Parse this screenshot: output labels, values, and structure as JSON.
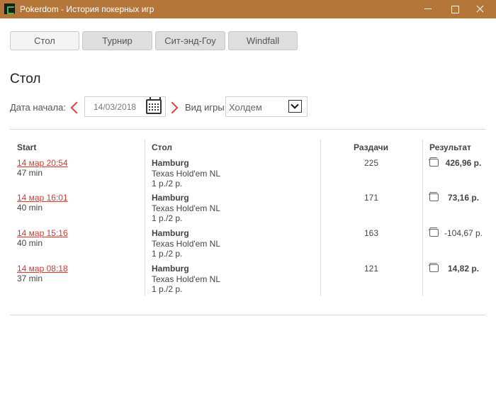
{
  "window": {
    "title": "Pokerdom - История покерных игр"
  },
  "tabs": [
    {
      "label": "Стол",
      "active": true
    },
    {
      "label": "Турнир",
      "active": false
    },
    {
      "label": "Сит-энд-Гоу",
      "active": false
    },
    {
      "label": "Windfall",
      "active": false
    }
  ],
  "page": {
    "heading": "Стол"
  },
  "filters": {
    "date_label": "Дата начала:",
    "date_value": "14/03/2018",
    "game_label": "Вид игры:",
    "game_value": "Холдем"
  },
  "table": {
    "headers": {
      "start": "Start",
      "table": "Стол",
      "hands": "Раздачи",
      "result": "Результат"
    },
    "rows": [
      {
        "start": "14 мар 20:54",
        "duration": "47 min",
        "table_name": "Hamburg",
        "game": "Texas Hold'em NL",
        "stakes": "1 р./2 р.",
        "hands": "225",
        "result": "426,96 р.",
        "result_bold": true
      },
      {
        "start": "14 мар 16:01",
        "duration": "40 min",
        "table_name": "Hamburg",
        "game": "Texas Hold'em NL",
        "stakes": "1 р./2 р.",
        "hands": "171",
        "result": "73,16 р.",
        "result_bold": true
      },
      {
        "start": "14 мар 15:16",
        "duration": "40 min",
        "table_name": "Hamburg",
        "game": "Texas Hold'em NL",
        "stakes": "1 р./2 р.",
        "hands": "163",
        "result": "-104,67 р.",
        "result_bold": false
      },
      {
        "start": "14 мар 08:18",
        "duration": "37 min",
        "table_name": "Hamburg",
        "game": "Texas Hold'em NL",
        "stakes": "1 р./2 р.",
        "hands": "121",
        "result": "14,82 р.",
        "result_bold": true
      }
    ]
  },
  "colors": {
    "titlebar": "#b5763a",
    "link": "#d63a2f",
    "arrow": "#d8423e"
  },
  "icons": [
    "pokerdom-logo-icon",
    "minimize-icon",
    "maximize-icon",
    "close-icon",
    "chevron-left-icon",
    "calendar-icon",
    "chevron-right-icon",
    "chevron-down-icon",
    "wallet-icon"
  ]
}
